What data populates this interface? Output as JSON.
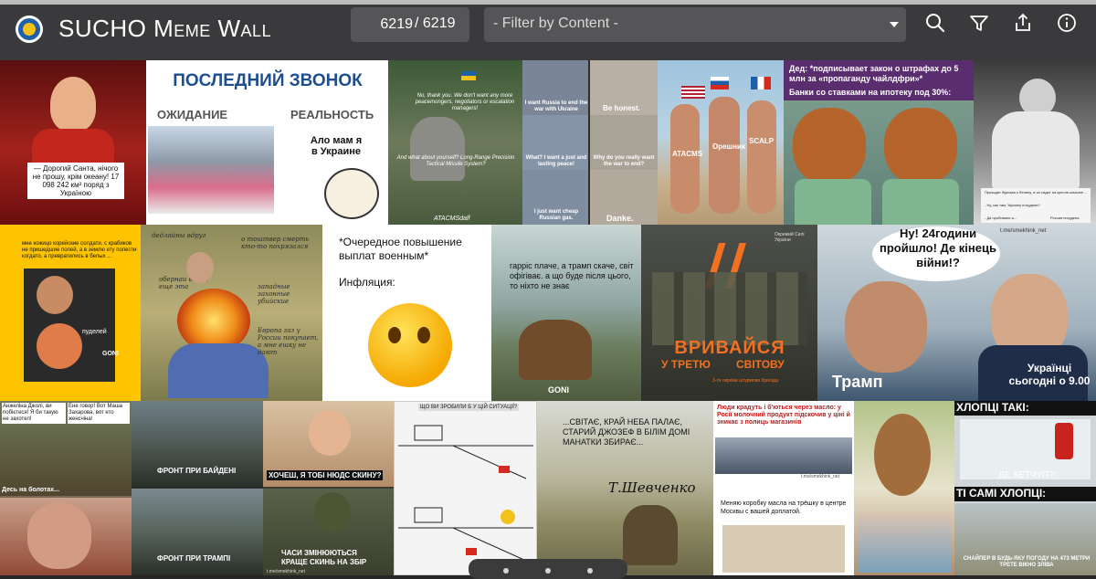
{
  "header": {
    "title": "SUCHO Meme Wall",
    "counter_value": "6219",
    "counter_total": "/ 6219",
    "filter_placeholder": "- Filter by Content -"
  },
  "icons": {
    "logo": "sucho-logo-icon",
    "search": "search-icon",
    "filter": "funnel-icon",
    "share": "share-icon",
    "info": "info-icon"
  },
  "colors": {
    "topbar": "#3a3a3c",
    "control_bg": "#555558",
    "accent_yellow": "#f2c21b",
    "accent_blue": "#1f5fa8"
  },
  "memes": [
    {
      "id": "m1",
      "texts": [
        "— Дорогий Санта, нічого не прошу, крім океану! 17 098 242 км² поряд з Україною"
      ]
    },
    {
      "id": "m2",
      "texts": [
        "ПОСЛЕДНИЙ ЗВОНОК",
        "ОЖИДАНИЕ",
        "РЕАЛЬНОСТЬ",
        "Ало мам я в Украине"
      ]
    },
    {
      "id": "m3",
      "texts": [
        "No, thank you. We don't want any more peacemongers, negotiators or escalation managers!",
        "And what about yourself? Long-Range Precision Tactical Missile System?",
        "ATACMSdalf"
      ]
    },
    {
      "id": "m4",
      "texts": [
        "I want Russia to end the war with Ukraine",
        "Be honest.",
        "What? I want a just and lasting peace!",
        "Why do you really want the war to end?",
        "I just want cheap Russian gas.",
        "Danke."
      ]
    },
    {
      "id": "m5",
      "texts": [
        "ATACMS",
        "Орешник",
        "SCALP"
      ]
    },
    {
      "id": "m6",
      "texts": [
        "Дед: *подписывает закон о штрафах до 5 млн за «пропаганду чайлдфри»*",
        "Банки со ставками на ипотеку под 30%:"
      ]
    },
    {
      "id": "m7",
      "texts": [
        "Приходит бурлака к Ленину, а он сидит на кресле-качалке ...",
        "- Ну, как там, Украину похудали?",
        "- Да пробовали а...",
        "Россия похудела"
      ]
    },
    {
      "id": "m8",
      "texts": [
        "мне кожицо корейские солдати, с крабиков не пришедшие полей, а в землю ету полегли когдато, а превратились в белых ...",
        "пуделей",
        "GONI"
      ]
    },
    {
      "id": "m9",
      "texts": [
        "дедлайны вдруг",
        "о тоштвер смерть кто-то похрязался",
        "обернаи война еще эта",
        "западные захонные убийские",
        "Европа газ у России покупает, а мне ешку не дают"
      ]
    },
    {
      "id": "m10",
      "texts": [
        "*Очередное повышение выплат военным*",
        "Инфляция:"
      ]
    },
    {
      "id": "m11",
      "texts": [
        "гарріс плаче, а трамп скаче, світ офігіває. а що буде після цього, то ніхто не знає",
        "GONI"
      ]
    },
    {
      "id": "m12",
      "texts": [
        "ВРИВАЙСЯ",
        "У ТРЕТЮ",
        "СВІТОВУ",
        "3-тя окрема штурмова бригада",
        "Окремий Силі України"
      ]
    },
    {
      "id": "m13",
      "texts": [
        "Ну! 24години пройшло! Де кінець війни!?",
        "Трамп",
        "Українці сьогодні о 9.00",
        "t.me/smekhink_net"
      ]
    },
    {
      "id": "m14",
      "texts": [
        "Анжеліна Джолі, ви побієтеся! Я би такую не захотел!",
        "Ене говор! Вот Маша Захарова, вот ето женсчіна!",
        "Десь на болотах..."
      ]
    },
    {
      "id": "m15",
      "texts": [
        "ФРОНТ ПРИ БАЙДЕНІ",
        "ФРОНТ ПРИ ТРАМПІ"
      ]
    },
    {
      "id": "m16",
      "texts": [
        "ХОЧЕШ, Я ТОБІ НЮДС СКИНУ?",
        "ЧАСИ ЗМІНЮЮТЬСЯ",
        "КРАЩЕ СКИНЬ НА ЗБІР",
        "t.me/smekhink_net"
      ]
    },
    {
      "id": "m17",
      "texts": [
        "ЩО ВИ ЗРОБИЛИ Б У ЦІЙ СИТУАЦІЇ?"
      ]
    },
    {
      "id": "m18",
      "texts": [
        "...СВІТАЄ, КРАЙ НЕБА ПАЛАЄ, СТАРИЙ ДЖОЗЕФ В БІЛІМ ДОМІ МАНАТКИ ЗБИРАЄ...",
        "Т.Шевченко"
      ]
    },
    {
      "id": "m19",
      "texts": [
        "Люди крадуть і б'ються через масло: у Росії молочний продукт підскочив у ціні й зникає з полиць магазинів",
        "Меняю коробку масла на трёшку в центре Москвы с вашей доплатой.",
        "t.me/smekhink_net"
      ]
    },
    {
      "id": "m20",
      "texts": []
    },
    {
      "id": "m21",
      "texts": [
        "ХЛОПЦІ ТАКІ:",
        "ДЕ КЕТЧУП?!",
        "ТІ САМІ ХЛОПЦІ:",
        "СНАЙПЕР В БУДЬ-ЯКУ ПОГОДУ НА 473 МЕТРИ ТРЕТЕ ВІКНО ЗЛІВА"
      ]
    }
  ]
}
